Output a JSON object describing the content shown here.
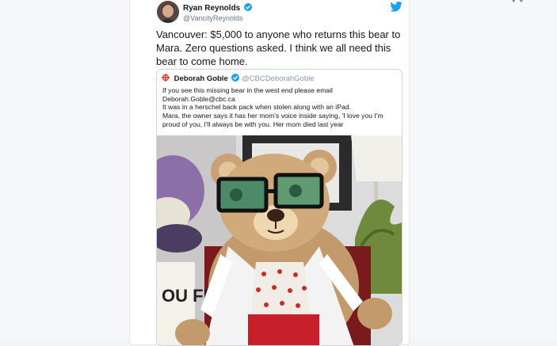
{
  "tweet": {
    "author_name": "Ryan Reynolds",
    "author_handle": "@VancityReynolds",
    "text": "Vancouver: $5,000 to anyone who returns this bear to Mara. Zero questions asked. I think we all need this bear to come home."
  },
  "quoted_tweet": {
    "author_name": "Deborah Goble",
    "author_handle": "@CBCDeborahGoble",
    "lines": [
      "If you see this missing bear in the west end please email",
      "Deborah.Goble@cbc.ca",
      "It was in a herschel back pack when stolen along with an iPad.",
      "Mara, the owner says it has her mom's voice inside saying, 'I love you I'm",
      "proud of you, I'll always be with you. Her mom died last year"
    ],
    "photo_sign_text": "OU FR"
  },
  "colors": {
    "twitter_blue": "#1da1f2",
    "cbc_red": "#d52b1e",
    "text_primary": "#14171a",
    "text_secondary": "#657786"
  }
}
